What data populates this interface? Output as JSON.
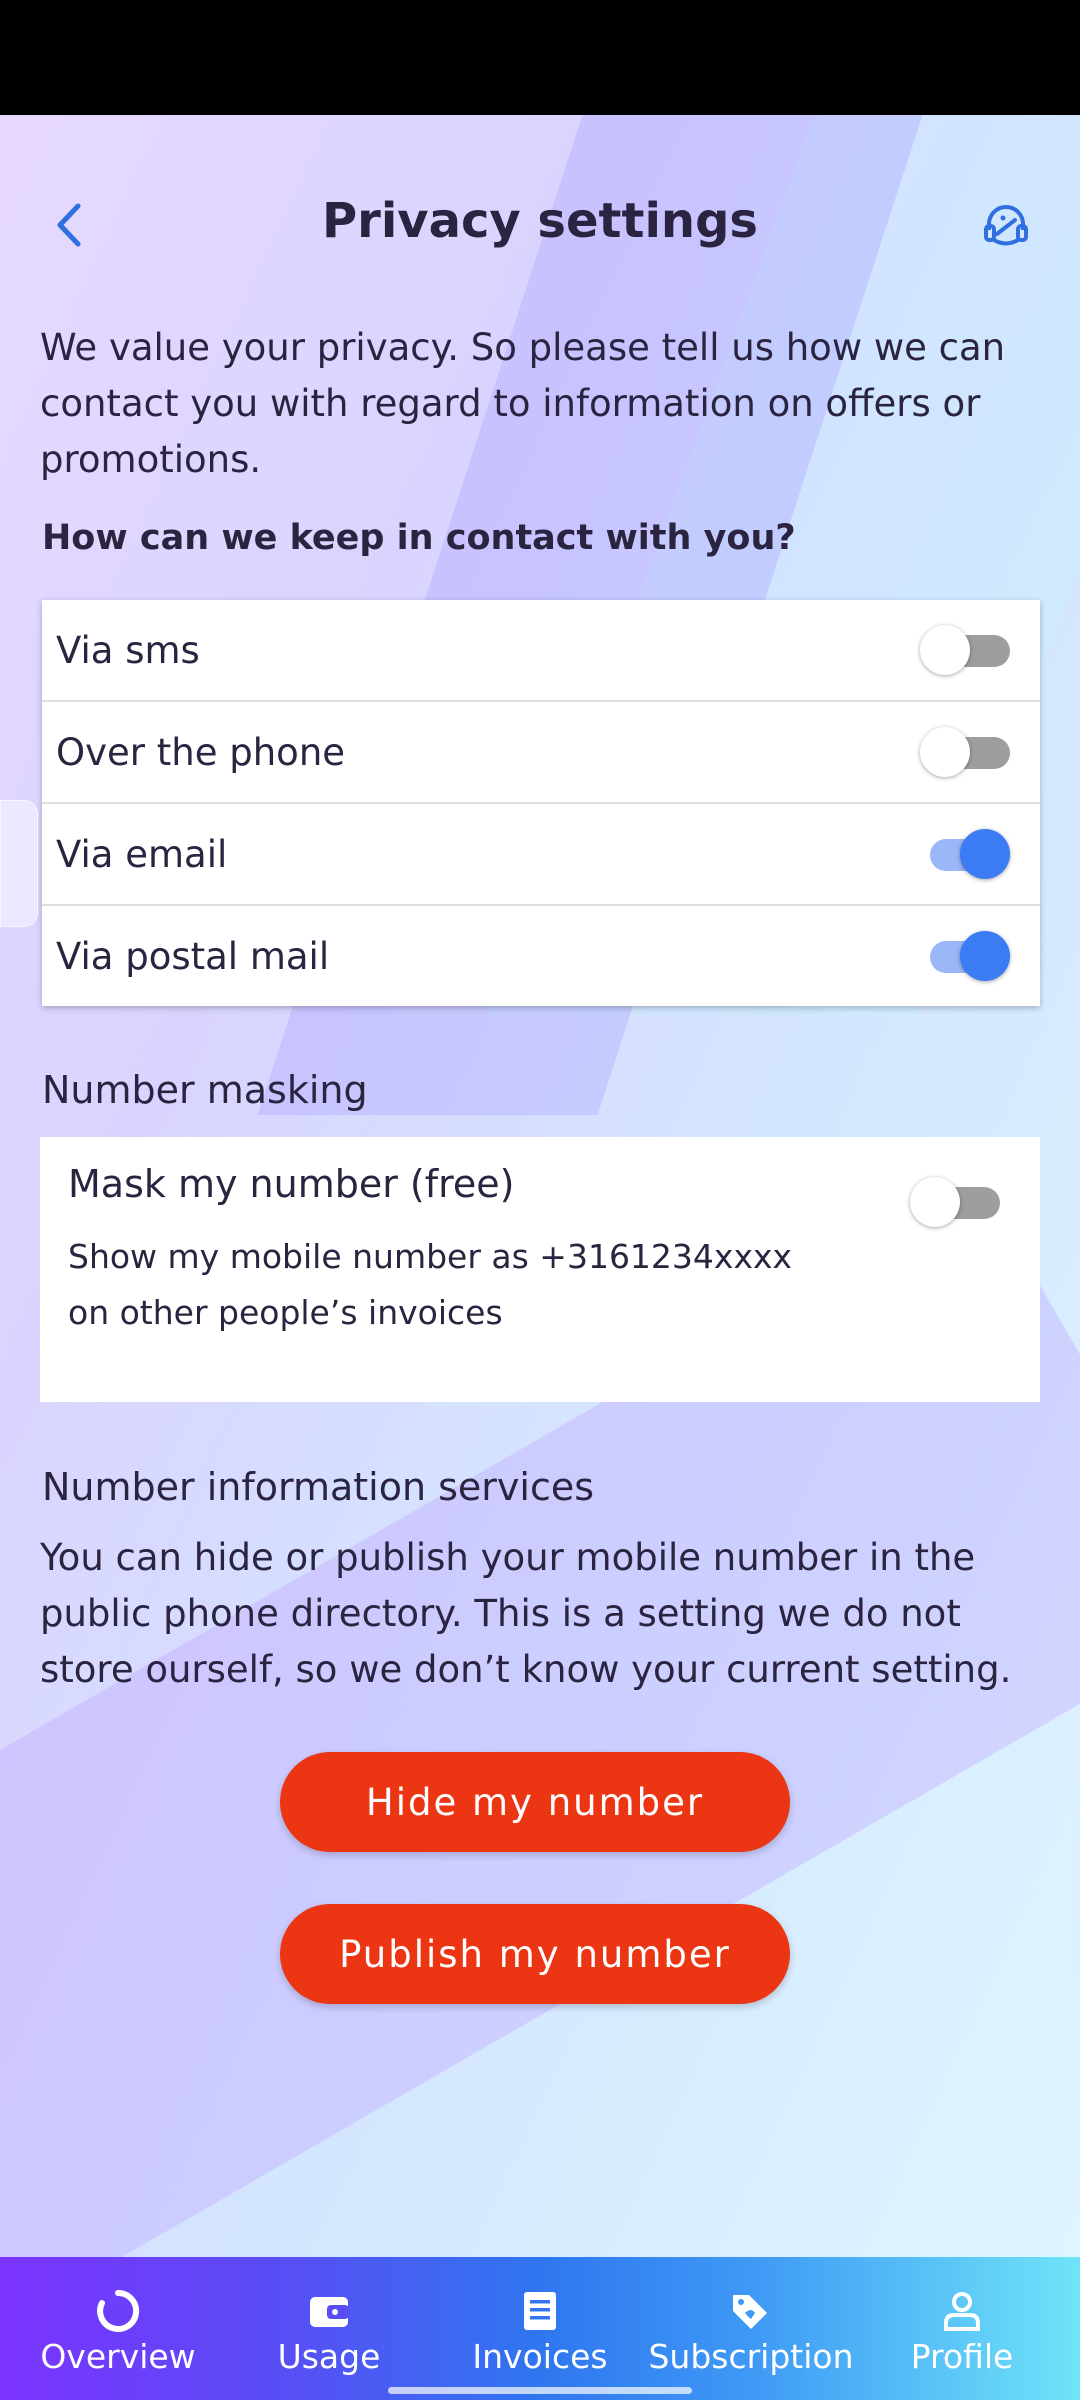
{
  "header": {
    "title": "Privacy settings"
  },
  "intro": "We value your privacy. So please tell us how we can contact you with regard to information on offers or promotions.",
  "contact": {
    "heading": "How can we keep in contact with you?",
    "options": [
      {
        "label": "Via sms",
        "on": false
      },
      {
        "label": "Over the phone",
        "on": false
      },
      {
        "label": "Via email",
        "on": true
      },
      {
        "label": "Via postal mail",
        "on": true
      }
    ]
  },
  "masking": {
    "heading": "Number masking",
    "title": "Mask my number (free)",
    "description": "Show my mobile number as +3161234xxxx on other people’s invoices",
    "on": false
  },
  "nis": {
    "heading": "Number information services",
    "text": "You can hide or publish your mobile number in the public phone directory. This is a setting we do not store ourself, so we don’t know your current setting.",
    "hide_label": "Hide my number",
    "publish_label": "Publish my number"
  },
  "nav": [
    {
      "label": "Overview",
      "icon": "overview-icon"
    },
    {
      "label": "Usage",
      "icon": "wallet-icon"
    },
    {
      "label": "Invoices",
      "icon": "invoice-icon"
    },
    {
      "label": "Subscription",
      "icon": "tag-icon"
    },
    {
      "label": "Profile",
      "icon": "profile-icon"
    }
  ],
  "colors": {
    "accent": "#3b7bf3",
    "cta": "#ec3512",
    "text": "#2b2440"
  }
}
